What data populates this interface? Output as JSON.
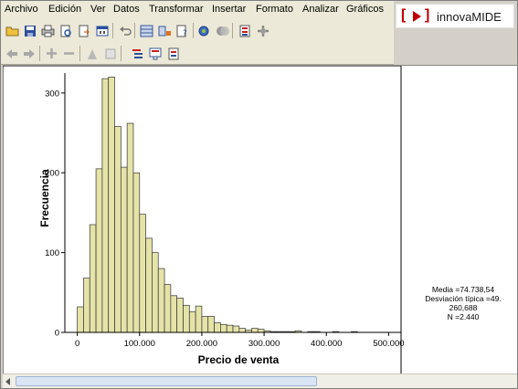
{
  "menubar": {
    "items": [
      "Archivo",
      "Edición",
      "Ver",
      "Datos",
      "Transformar",
      "Insertar",
      "Formato",
      "Analizar",
      "Gráficos"
    ]
  },
  "logo": {
    "open_bracket": "[",
    "close_bracket": "]",
    "text": "innovaMIDE",
    "color": "#c00000"
  },
  "toolbar1": {
    "icons": [
      "open-folder-icon",
      "save-icon",
      "print-icon",
      "print-preview-icon",
      "export-icon",
      "dialog-recall-icon",
      "undo-icon",
      "goto-case-icon",
      "variables-icon",
      "find-icon",
      "chart-builder-icon",
      "sets-icon",
      "insert-output-icon",
      "gear-icon"
    ]
  },
  "toolbar2": {
    "icons": [
      "back-arrow-icon",
      "forward-arrow-icon",
      "expand-icon",
      "collapse-icon",
      "show-icon",
      "hide-icon",
      "insert-heading-icon",
      "insert-title-icon",
      "insert-text-icon"
    ]
  },
  "chart_data": {
    "type": "bar",
    "xlabel": "Precio de venta",
    "ylabel": "Frecuencia",
    "xlim": [
      -20000,
      520000
    ],
    "ylim": [
      0,
      325
    ],
    "x_ticks": [
      "0",
      "100.000",
      "200.000",
      "300.000",
      "400.000",
      "500.000"
    ],
    "x_tick_values": [
      0,
      100000,
      200000,
      300000,
      400000,
      500000
    ],
    "y_ticks": [
      0,
      100,
      200,
      300
    ],
    "bin_width": 10000,
    "bin_starts": [
      0,
      10000,
      20000,
      30000,
      40000,
      50000,
      60000,
      70000,
      80000,
      90000,
      100000,
      110000,
      120000,
      130000,
      140000,
      150000,
      160000,
      170000,
      180000,
      190000,
      200000,
      210000,
      220000,
      230000,
      240000,
      250000,
      260000,
      270000,
      280000,
      290000,
      300000,
      310000,
      320000,
      330000,
      340000,
      350000,
      360000,
      370000,
      380000,
      390000,
      400000,
      410000,
      420000,
      430000,
      440000,
      450000,
      460000,
      470000,
      480000,
      490000
    ],
    "values": [
      32,
      68,
      135,
      205,
      318,
      320,
      258,
      207,
      262,
      200,
      148,
      118,
      100,
      80,
      60,
      46,
      43,
      34,
      26,
      33,
      20,
      20,
      12,
      10,
      9,
      8,
      5,
      3,
      5,
      4,
      2,
      1,
      1,
      1,
      1,
      2,
      0,
      1,
      1,
      0,
      0,
      1,
      0,
      0,
      1,
      0,
      0,
      0,
      0,
      0
    ],
    "bar_color": "#e6e3a8",
    "bar_stroke": "#333333",
    "grid": false
  },
  "stats": {
    "line1": "Media =74.738,54",
    "line2": "Desviación típica =49.",
    "line3": "260,688",
    "line4": "N =2.440"
  }
}
